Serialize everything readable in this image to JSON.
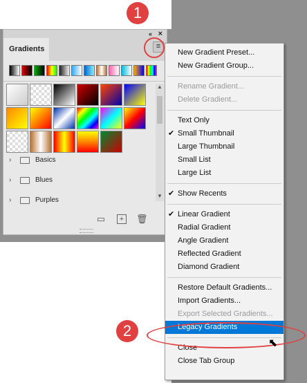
{
  "panel": {
    "tab_label": "Gradients",
    "collapse_glyph": "‹‹",
    "close_glyph": "×",
    "menu_glyph": "≡",
    "recent_swatches": [
      "linear-gradient(90deg,#000,#fff)",
      "linear-gradient(90deg,#d00,#000)",
      "linear-gradient(90deg,#0a0,#000)",
      "linear-gradient(90deg,#f00,#ff0,#0f0)",
      "linear-gradient(90deg,#222,#eee)",
      "linear-gradient(90deg,#3af,#fff)",
      "linear-gradient(90deg,#06c,#8ef)",
      "linear-gradient(90deg,#b87333,#fff,#b87333)",
      "linear-gradient(90deg,#f6a,#fff)",
      "linear-gradient(90deg,#0bd,#fff)",
      "linear-gradient(90deg,#fa0,#00f)",
      "linear-gradient(90deg,#f00,#ff0,#0f0,#0ff,#00f,#f0f)"
    ],
    "grid_swatches": [
      "linear-gradient(135deg,#fff,#ccc)",
      "repeating-conic-gradient(#ddd 0 25%,#fff 0 50%) 0 0/8px 8px",
      "linear-gradient(135deg,#000,#fff)",
      "linear-gradient(135deg,#c00,#000)",
      "linear-gradient(135deg,#f40,#00a)",
      "linear-gradient(135deg,#00f,#ff0)",
      "linear-gradient(135deg,#f80,#ff0)",
      "linear-gradient(135deg,#ff0,#f00)",
      "linear-gradient(135deg,#03a,#fff,#03a)",
      "linear-gradient(135deg,#f00,#ff0,#0f0,#0ff,#00f,#f0f)",
      "linear-gradient(135deg,#f0f,#0ff,#ff0)",
      "linear-gradient(135deg,#ff0,#f00,#00f)",
      "repeating-conic-gradient(#ddd 0 25%,#fff 0 50%) 0 0/8px 8px",
      "linear-gradient(90deg,#b87333,#fff,#b87333)",
      "linear-gradient(90deg,#f00,#ff0,#f00)",
      "linear-gradient(180deg,#ff0,#f80,#f00)",
      "linear-gradient(135deg,#083,#c00)"
    ],
    "folders": [
      {
        "label": "Basics"
      },
      {
        "label": "Blues"
      },
      {
        "label": "Purples"
      }
    ]
  },
  "menu": {
    "items": [
      {
        "label": "New Gradient Preset...",
        "state": "enabled",
        "checked": false
      },
      {
        "label": "New Gradient Group...",
        "state": "enabled",
        "checked": false
      },
      {
        "label": "Rename Gradient...",
        "state": "disabled",
        "checked": false
      },
      {
        "label": "Delete Gradient...",
        "state": "disabled",
        "checked": false
      },
      {
        "label": "Text Only",
        "state": "enabled",
        "checked": false
      },
      {
        "label": "Small Thumbnail",
        "state": "enabled",
        "checked": true
      },
      {
        "label": "Large Thumbnail",
        "state": "enabled",
        "checked": false
      },
      {
        "label": "Small List",
        "state": "enabled",
        "checked": false
      },
      {
        "label": "Large List",
        "state": "enabled",
        "checked": false
      },
      {
        "label": "Show Recents",
        "state": "enabled",
        "checked": true
      },
      {
        "label": "Linear Gradient",
        "state": "enabled",
        "checked": true
      },
      {
        "label": "Radial Gradient",
        "state": "enabled",
        "checked": false
      },
      {
        "label": "Angle Gradient",
        "state": "enabled",
        "checked": false
      },
      {
        "label": "Reflected Gradient",
        "state": "enabled",
        "checked": false
      },
      {
        "label": "Diamond Gradient",
        "state": "enabled",
        "checked": false
      },
      {
        "label": "Restore Default Gradients...",
        "state": "enabled",
        "checked": false
      },
      {
        "label": "Import Gradients...",
        "state": "enabled",
        "checked": false
      },
      {
        "label": "Export Selected Gradients...",
        "state": "disabled",
        "checked": false
      },
      {
        "label": "Legacy Gradients",
        "state": "highlighted",
        "checked": false
      },
      {
        "label": "Close",
        "state": "enabled",
        "checked": false
      },
      {
        "label": "Close Tab Group",
        "state": "enabled",
        "checked": false
      }
    ],
    "check_glyph": "✔"
  },
  "annotations": {
    "step1": "1",
    "step2": "2",
    "color": "#e04040"
  },
  "colors": {
    "highlight": "#0078d7",
    "background": "#8f8f8f"
  }
}
